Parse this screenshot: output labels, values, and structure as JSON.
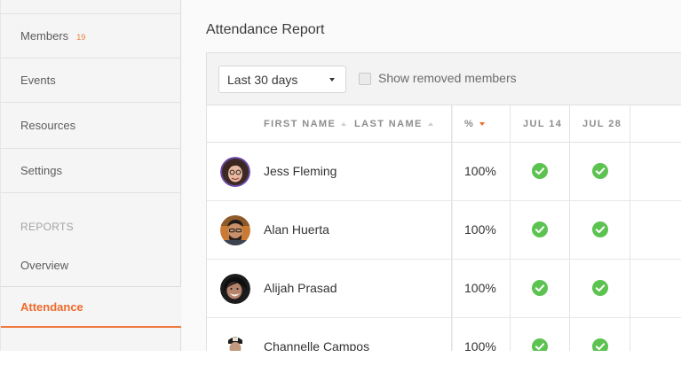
{
  "sidebar": {
    "members": {
      "label": "Members",
      "count": "19"
    },
    "events": "Events",
    "resources": "Resources",
    "settings": "Settings",
    "reports_heading": "REPORTS",
    "overview": "Overview",
    "attendance": "Attendance",
    "active_color": "#ee6a2b"
  },
  "main": {
    "title": "Attendance Report",
    "range_select": {
      "value": "Last 30 days"
    },
    "show_removed": {
      "label": "Show removed members",
      "checked": false
    },
    "columns": {
      "first_name": "FIRST NAME",
      "last_name": "LAST NAME",
      "percent": "%",
      "dates": [
        "JUL 14",
        "JUL 28"
      ]
    },
    "rows": [
      {
        "name": "Jess Fleming",
        "percent": "100%",
        "attended": [
          true,
          true
        ]
      },
      {
        "name": "Alan Huerta",
        "percent": "100%",
        "attended": [
          true,
          true
        ]
      },
      {
        "name": "Alijah Prasad",
        "percent": "100%",
        "attended": [
          true,
          true
        ]
      },
      {
        "name": "Channelle Campos",
        "percent": "100%",
        "attended": [
          true,
          true
        ]
      }
    ],
    "check_color": "#5cc351"
  }
}
